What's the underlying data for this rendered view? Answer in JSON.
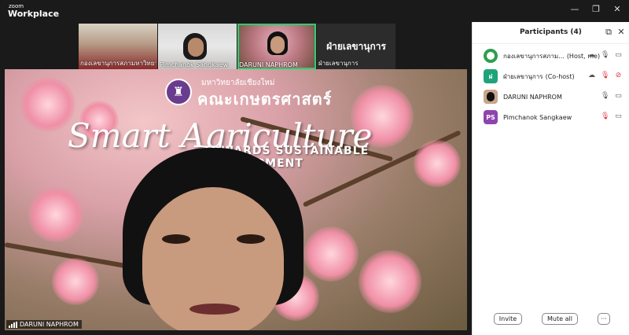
{
  "app": {
    "brand_small": "zoom",
    "brand_main": "Workplace"
  },
  "window_controls": {
    "minimize": "—",
    "restore": "❐",
    "close": "✕"
  },
  "thumbnails": [
    {
      "label": "กองเลขานุการสภามหาวิทยาลัย...",
      "active": false
    },
    {
      "label": "Pimchanok Sangkaew",
      "active": false
    },
    {
      "label": "DARUNI NAPHROM",
      "active": true
    },
    {
      "label": "ฝ่ายเลขานุการ",
      "big_name": "ฝ่ายเลขานุการ",
      "active": false
    }
  ],
  "stage": {
    "univ": "มหาวิทยาลัยเชียงใหม่",
    "faculty": "คณะเกษตรศาสตร์",
    "smart": "Smart Agriculture",
    "towards": "TOWARDS SUSTAINABLE DEVELOPMENT",
    "speaker_name": "DARUNI NAPHROM"
  },
  "participants_panel": {
    "title": "Participants (4)",
    "list": [
      {
        "name": "กองเลขานุการสภาม...",
        "role": "(Host, me)",
        "avatar_color": "#2e9e4f",
        "avatar_text": "",
        "mic_muted": false,
        "video_off": false
      },
      {
        "name": "ฝ่ายเลขานุการ",
        "role": "(Co-host)",
        "avatar_color": "#1fa37a",
        "avatar_text": "ฝ",
        "mic_muted": true,
        "video_off": true
      },
      {
        "name": "DARUNI NAPHROM",
        "role": "",
        "avatar_color": "#c9a58a",
        "avatar_text": "",
        "mic_muted": false,
        "video_off": false
      },
      {
        "name": "Pimchanok Sangkaew",
        "role": "",
        "avatar_color": "#8e44ad",
        "avatar_text": "PS",
        "mic_muted": true,
        "video_off": false
      }
    ],
    "invite": "Invite",
    "mute_all": "Mute all",
    "more": "···"
  }
}
